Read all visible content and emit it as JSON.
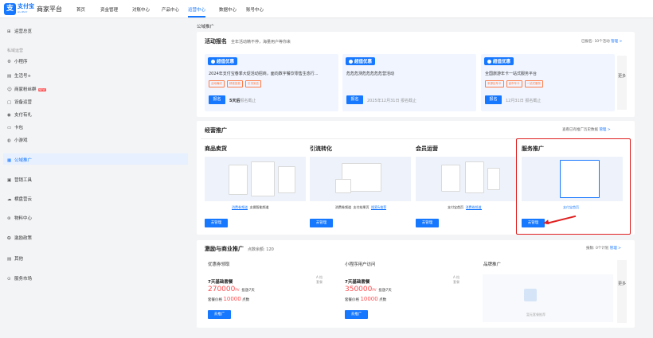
{
  "header": {
    "brand": "支付宝",
    "brand_sub": "ALIPAY",
    "platform": "商家平台",
    "nav": [
      {
        "label": "首页"
      },
      {
        "label": "资金管理"
      },
      {
        "label": "对账中心"
      },
      {
        "label": "产品中心"
      },
      {
        "label": "运营中心"
      },
      {
        "label": "数据中心"
      },
      {
        "label": "账号中心"
      }
    ],
    "active_nav": "运营中心"
  },
  "sidebar": {
    "overview": "运营总览",
    "group_label": "私域运营",
    "items": [
      {
        "label": "小程序",
        "icon": "mini-app-icon",
        "glyph": "⚙"
      },
      {
        "label": "生活号+",
        "icon": "life-account-icon",
        "glyph": "▤"
      },
      {
        "label": "商家粉丝群",
        "icon": "fans-group-icon",
        "glyph": "☺",
        "badge": "NEW"
      },
      {
        "label": "设备运营",
        "icon": "device-icon",
        "glyph": "▢"
      },
      {
        "label": "支付有礼",
        "icon": "pay-gift-icon",
        "glyph": "◉"
      },
      {
        "label": "卡包",
        "icon": "card-icon",
        "glyph": "▭"
      },
      {
        "label": "小游戏",
        "icon": "game-icon",
        "glyph": "◍"
      }
    ],
    "sections": [
      {
        "label": "公域推广",
        "icon": "public-promo-icon",
        "glyph": "▦",
        "active": true
      },
      {
        "label": "营销工具",
        "icon": "marketing-tool-icon",
        "glyph": "▣"
      },
      {
        "label": "横盘营云",
        "icon": "cloud-icon",
        "glyph": "☁"
      },
      {
        "label": "物料中心",
        "icon": "material-icon",
        "glyph": "⊛"
      },
      {
        "label": "激励政策",
        "icon": "incentive-icon",
        "glyph": "✪"
      },
      {
        "label": "其他",
        "icon": "other-icon",
        "glyph": "▤"
      },
      {
        "label": "服务市场",
        "icon": "service-market-icon",
        "glyph": "⊙"
      }
    ]
  },
  "breadcrumb": "公域推广",
  "activity": {
    "title": "活动报名",
    "subtitle": "全年活动精不停，海量用户等你来",
    "right": "已报名: 10个活动",
    "manage": "管理 >",
    "more": "更多",
    "cards": [
      {
        "tag": "超值优惠",
        "desc": "2024年支付宝春季大促活动招商，面向数字餐饮零售生态行...",
        "labels": [
          "活动曝光",
          "精准投放",
          "引流到店"
        ],
        "button": "报名",
        "deadline_strong": "5天后",
        "deadline": "报名截止"
      },
      {
        "tag": "超值优惠",
        "desc": "危危危测危危危危危营活动",
        "labels": [],
        "button": "报名",
        "deadline_strong": "",
        "deadline": "2025年12月31日 报名截止"
      },
      {
        "tag": "超值优惠",
        "desc": "全国旅游年卡一站式服务平台",
        "labels": [
          "来源区年卡",
          "省市年卡",
          "一站式服务"
        ],
        "button": "报名",
        "deadline_strong": "",
        "deadline": "12月31日 报名截止"
      }
    ]
  },
  "business": {
    "title": "经营推广",
    "right": "查看已有推广历史数据",
    "manage": "管理 >",
    "columns": [
      {
        "title": "商品卖货",
        "tabs": [
          "消费卷频道",
          "支操智能频道"
        ],
        "active_tab": 0,
        "button": "去管理"
      },
      {
        "title": "引流转化",
        "tabs": [
          "消费卷频道",
          "支付结果页",
          "搜索&推荐"
        ],
        "active_tab": 2,
        "button": "去管理"
      },
      {
        "title": "会员运营",
        "tabs": [
          "支付宝首页",
          "消费卷频道"
        ],
        "active_tab": 1,
        "button": "去管理"
      },
      {
        "title": "服务推广",
        "tabs": [
          "支付宝首页"
        ],
        "active_tab": 0,
        "button": "去管理"
      }
    ]
  },
  "incentive": {
    "title": "激励与商业推广",
    "balance": "点数余额: 120",
    "right": "报数: 0个计划",
    "manage": "管理 >",
    "more": "更多",
    "columns": [
      {
        "name": "优惠券领取",
        "package": "7天基础套餐",
        "pv": "270000",
        "pv_unit": "PV",
        "pv_tail": "投放7天",
        "price_label": "套餐价格",
        "price": "10000",
        "price_unit": "点数",
        "side": "A 档\n套餐",
        "button": "去推广"
      },
      {
        "name": "小程序用户访问",
        "package": "7天基础套餐",
        "pv": "350000",
        "pv_unit": "PV",
        "pv_tail": "投放7天",
        "price_label": "套餐价格",
        "price": "10000",
        "price_unit": "点数",
        "side": "A 档\n套餐",
        "button": "去推广"
      },
      {
        "name": "品牌推广",
        "empty": "暂无套餐推荐"
      }
    ]
  }
}
